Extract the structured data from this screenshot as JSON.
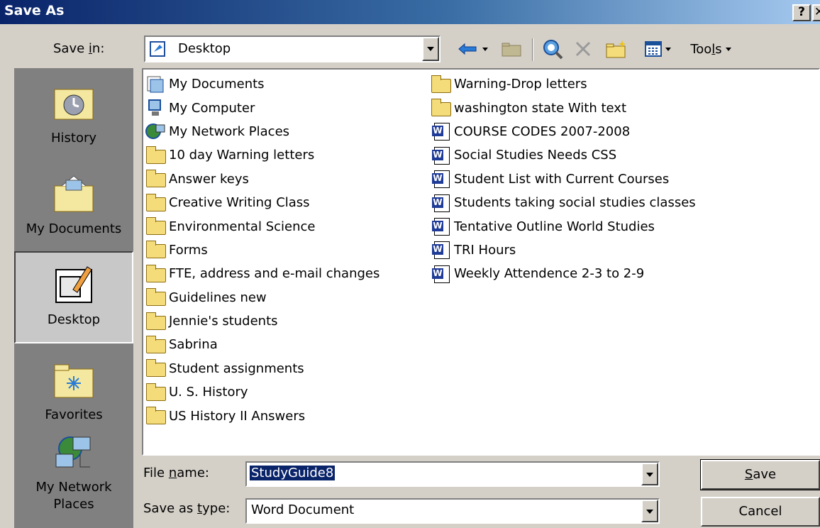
{
  "window": {
    "title": "Save As",
    "help": "?",
    "close": "✕"
  },
  "save_in": {
    "label_pre": "Save ",
    "label_u": "i",
    "label_post": "n:",
    "location": "Desktop"
  },
  "toolbar": {
    "tools_label_pre": "Too",
    "tools_label_u": "l",
    "tools_label_post": "s"
  },
  "places": [
    {
      "label": "History"
    },
    {
      "label": "My Documents"
    },
    {
      "label": "Desktop"
    },
    {
      "label": "Favorites"
    },
    {
      "label_line1": "My Network",
      "label_line2": "Places"
    }
  ],
  "files_col1": [
    {
      "name": "My Documents",
      "icon": "mydocs-icon"
    },
    {
      "name": "My Computer",
      "icon": "computer-icon"
    },
    {
      "name": "My Network Places",
      "icon": "network-icon"
    },
    {
      "name": "10 day Warning letters",
      "icon": "folder-icon"
    },
    {
      "name": "Answer keys",
      "icon": "folder-icon"
    },
    {
      "name": "Creative Writing Class",
      "icon": "folder-icon"
    },
    {
      "name": "Environmental Science",
      "icon": "folder-icon"
    },
    {
      "name": "Forms",
      "icon": "folder-icon"
    },
    {
      "name": "FTE, address and e-mail changes",
      "icon": "folder-icon"
    },
    {
      "name": "Guidelines new",
      "icon": "folder-icon"
    },
    {
      "name": "Jennie's students",
      "icon": "folder-icon"
    },
    {
      "name": "Sabrina",
      "icon": "folder-icon"
    },
    {
      "name": "Student assignments",
      "icon": "folder-icon"
    },
    {
      "name": "U. S. History",
      "icon": "folder-icon"
    },
    {
      "name": "US History II Answers",
      "icon": "folder-icon"
    }
  ],
  "files_col2": [
    {
      "name": "Warning-Drop letters",
      "icon": "folder-icon"
    },
    {
      "name": "washington state With text",
      "icon": "folder-icon"
    },
    {
      "name": "COURSE CODES  2007-2008",
      "icon": "word-doc-icon"
    },
    {
      "name": "Social Studies Needs CSS",
      "icon": "word-doc-icon"
    },
    {
      "name": "Student List with Current Courses",
      "icon": "word-doc-icon"
    },
    {
      "name": "Students taking social studies classes",
      "icon": "word-doc-icon"
    },
    {
      "name": "Tentative Outline World Studies",
      "icon": "word-doc-icon"
    },
    {
      "name": "TRI Hours",
      "icon": "word-doc-icon"
    },
    {
      "name": "Weekly Attendence 2-3 to 2-9",
      "icon": "word-doc-icon"
    }
  ],
  "filename": {
    "label_pre": "File ",
    "label_u": "n",
    "label_post": "ame:",
    "value": "StudyGuide8"
  },
  "savetype": {
    "label_pre": "Save as ",
    "label_u": "t",
    "label_post": "ype:",
    "value": "Word Document"
  },
  "buttons": {
    "save_u": "S",
    "save_post": "ave",
    "cancel": "Cancel"
  }
}
